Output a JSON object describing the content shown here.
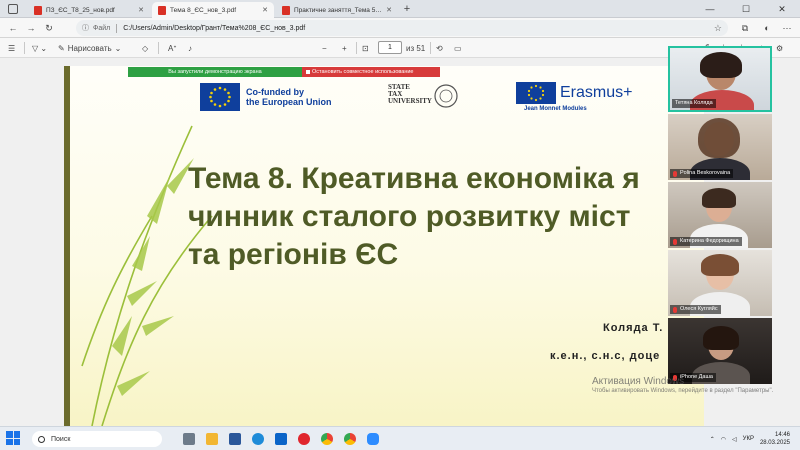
{
  "browser": {
    "tabs": [
      {
        "label": "ПЗ_ЄС_Т8_25_нов.pdf",
        "active": false
      },
      {
        "label": "Тема 8_ЄС_нов_3.pdf",
        "active": true
      },
      {
        "label": "Практичне заняття_Тема 5_Фінан",
        "active": false
      }
    ],
    "new_tab": "+",
    "window_controls": {
      "minimize": "—",
      "maximize": "☐",
      "close": "✕"
    }
  },
  "address_bar": {
    "prefix": "Файл",
    "url": "C:/Users/Admin/Desktop/Грант/Тема%208_ЄС_нов_3.pdf"
  },
  "pdf_toolbar": {
    "draw_label": "Нарисовать",
    "page_current": "1",
    "page_total": "из 51",
    "zoom_out": "−",
    "zoom_in": "+"
  },
  "share_banner": {
    "status": "Вы запустили демонстрацию экрана",
    "stop": "Остановить совместное использование"
  },
  "slide": {
    "logo_eu": [
      "Co-funded by",
      "the European Union"
    ],
    "logo_tax": [
      "STATE",
      "TAX",
      "UNIVERSITY"
    ],
    "logo_erasmus": "Erasmus+",
    "logo_erasmus_sub": "Jean Monnet Modules",
    "title_lines": [
      "Тема 8. Креативна економіка я",
      "чинник сталого розвитку міст",
      "та регіонів ЄС"
    ],
    "author": "Коляда Т.",
    "degree": "к.е.н., с.н.с, доце"
  },
  "participants": [
    {
      "name": "Тетяна Коляда",
      "muted": false,
      "active": true
    },
    {
      "name": "Polina Beskorovaina",
      "muted": true,
      "active": false
    },
    {
      "name": "Катерина Федорищина",
      "muted": true,
      "active": false
    },
    {
      "name": "Олеся Кугляйс",
      "muted": true,
      "active": false
    },
    {
      "name": "iPhone Даша",
      "muted": true,
      "active": false
    }
  ],
  "watermark": {
    "title": "Активация Windows",
    "subtitle": "Чтобы активировать Windows, перейдите в раздел \"Параметры\"."
  },
  "taskbar": {
    "search_placeholder": "Поиск",
    "language": "УКР",
    "time": "14:46",
    "date": "28.03.2025"
  },
  "colors": {
    "title_text": "#4f5b26",
    "share_green": "#2ea043",
    "share_red": "#d73a3a",
    "active_speaker": "#25c2a0",
    "eu_blue": "#0f3f9c"
  }
}
